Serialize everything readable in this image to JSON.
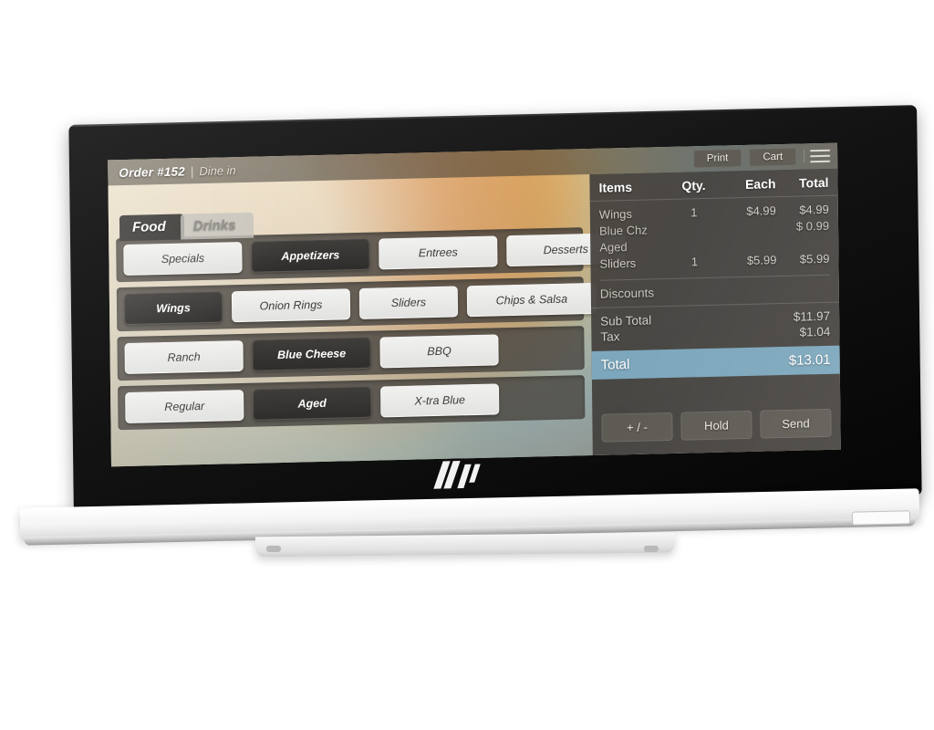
{
  "device": {
    "brand_logo": "hp-logo"
  },
  "topbar": {
    "order_label": "Order #152",
    "separator": "|",
    "order_type": "Dine in",
    "print_label": "Print",
    "cart_label": "Cart",
    "menu_icon": "hamburger-menu-icon"
  },
  "tabs": [
    {
      "label": "Food",
      "active": true
    },
    {
      "label": "Drinks",
      "active": false
    }
  ],
  "menu_rows": [
    {
      "name": "category-row",
      "buttons": [
        {
          "label": "Specials",
          "selected": false
        },
        {
          "label": "Appetizers",
          "selected": true
        },
        {
          "label": "Entrees",
          "selected": false
        },
        {
          "label": "Desserts",
          "selected": false
        }
      ]
    },
    {
      "name": "item-row",
      "buttons": [
        {
          "label": "Wings",
          "selected": true
        },
        {
          "label": "Onion Rings",
          "selected": false
        },
        {
          "label": "Sliders",
          "selected": false
        },
        {
          "label": "Chips & Salsa",
          "selected": false
        }
      ]
    },
    {
      "name": "sauce-row",
      "buttons": [
        {
          "label": "Ranch",
          "selected": false
        },
        {
          "label": "Blue Cheese",
          "selected": true
        },
        {
          "label": "BBQ",
          "selected": false
        }
      ]
    },
    {
      "name": "modifier-row",
      "buttons": [
        {
          "label": "Regular",
          "selected": false
        },
        {
          "label": "Aged",
          "selected": true
        },
        {
          "label": "X-tra Blue",
          "selected": false
        }
      ]
    }
  ],
  "receipt": {
    "headers": {
      "items": "Items",
      "qty": "Qty.",
      "each": "Each",
      "total": "Total"
    },
    "lines": [
      {
        "name": "Wings",
        "qty": "1",
        "each": "$4.99",
        "total": "$4.99",
        "modifier": false
      },
      {
        "name": "Blue Chz",
        "qty": "",
        "each": "",
        "total": "$ 0.99",
        "modifier": true
      },
      {
        "name": "Aged",
        "qty": "",
        "each": "",
        "total": "",
        "modifier": true
      },
      {
        "name": "Sliders",
        "qty": "1",
        "each": "$5.99",
        "total": "$5.99",
        "modifier": false
      }
    ],
    "discounts_label": "Discounts",
    "subtotal_label": "Sub Total",
    "subtotal_value": "$11.97",
    "tax_label": "Tax",
    "tax_value": "$1.04",
    "total_label": "Total",
    "total_value": "$13.01",
    "total_highlight_color": "#7da7bc"
  },
  "actions": [
    {
      "label": "+ / -"
    },
    {
      "label": "Hold"
    },
    {
      "label": "Send"
    }
  ]
}
